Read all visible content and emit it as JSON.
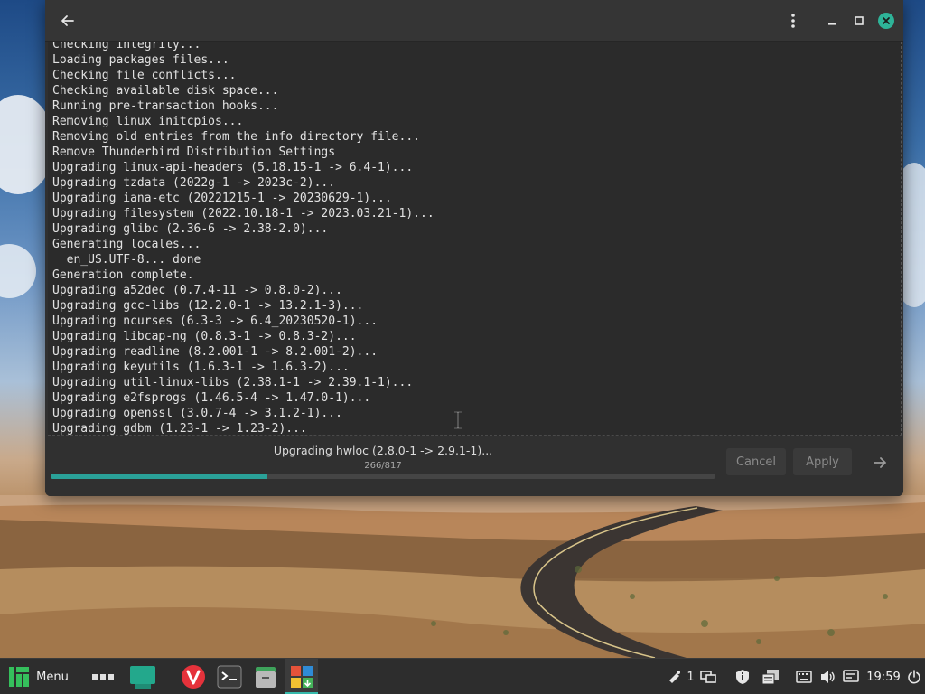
{
  "window": {
    "log_lines": [
      "Checking integrity...",
      "Loading packages files...",
      "Checking file conflicts...",
      "Checking available disk space...",
      "Running pre-transaction hooks...",
      "Removing linux initcpios...",
      "Removing old entries from the info directory file...",
      "Remove Thunderbird Distribution Settings",
      "Upgrading linux-api-headers (5.18.15-1 -> 6.4-1)...",
      "Upgrading tzdata (2022g-1 -> 2023c-2)...",
      "Upgrading iana-etc (20221215-1 -> 20230629-1)...",
      "Upgrading filesystem (2022.10.18-1 -> 2023.03.21-1)...",
      "Upgrading glibc (2.36-6 -> 2.38-2.0)...",
      "Generating locales...",
      "  en_US.UTF-8... done",
      "Generation complete.",
      "Upgrading a52dec (0.7.4-11 -> 0.8.0-2)...",
      "Upgrading gcc-libs (12.2.0-1 -> 13.2.1-3)...",
      "Upgrading ncurses (6.3-3 -> 6.4_20230520-1)...",
      "Upgrading libcap-ng (0.8.3-1 -> 0.8.3-2)...",
      "Upgrading readline (8.2.001-1 -> 8.2.001-2)...",
      "Upgrading keyutils (1.6.3-1 -> 1.6.3-2)...",
      "Upgrading util-linux-libs (2.38.1-1 -> 2.39.1-1)...",
      "Upgrading e2fsprogs (1.46.5-4 -> 1.47.0-1)...",
      "Upgrading openssl (3.0.7-4 -> 3.1.2-1)...",
      "Upgrading gdbm (1.23-1 -> 1.23-2)..."
    ],
    "status": "Upgrading hwloc (2.8.0-1 -> 2.9.1-1)...",
    "count": "266/817",
    "progress_fraction": 0.3256,
    "cancel_label": "Cancel",
    "apply_label": "Apply",
    "icons": {
      "back": "back-arrow-icon",
      "kebab": "kebab-menu-icon",
      "minimize": "minimize-icon",
      "maximize": "maximize-icon",
      "close": "close-icon",
      "next": "forward-arrow-icon"
    },
    "accent_color": "#2aa198",
    "close_color": "#2eb398"
  },
  "taskbar": {
    "menu_label": "Menu",
    "notification_count": "1",
    "clock": "19:59"
  }
}
